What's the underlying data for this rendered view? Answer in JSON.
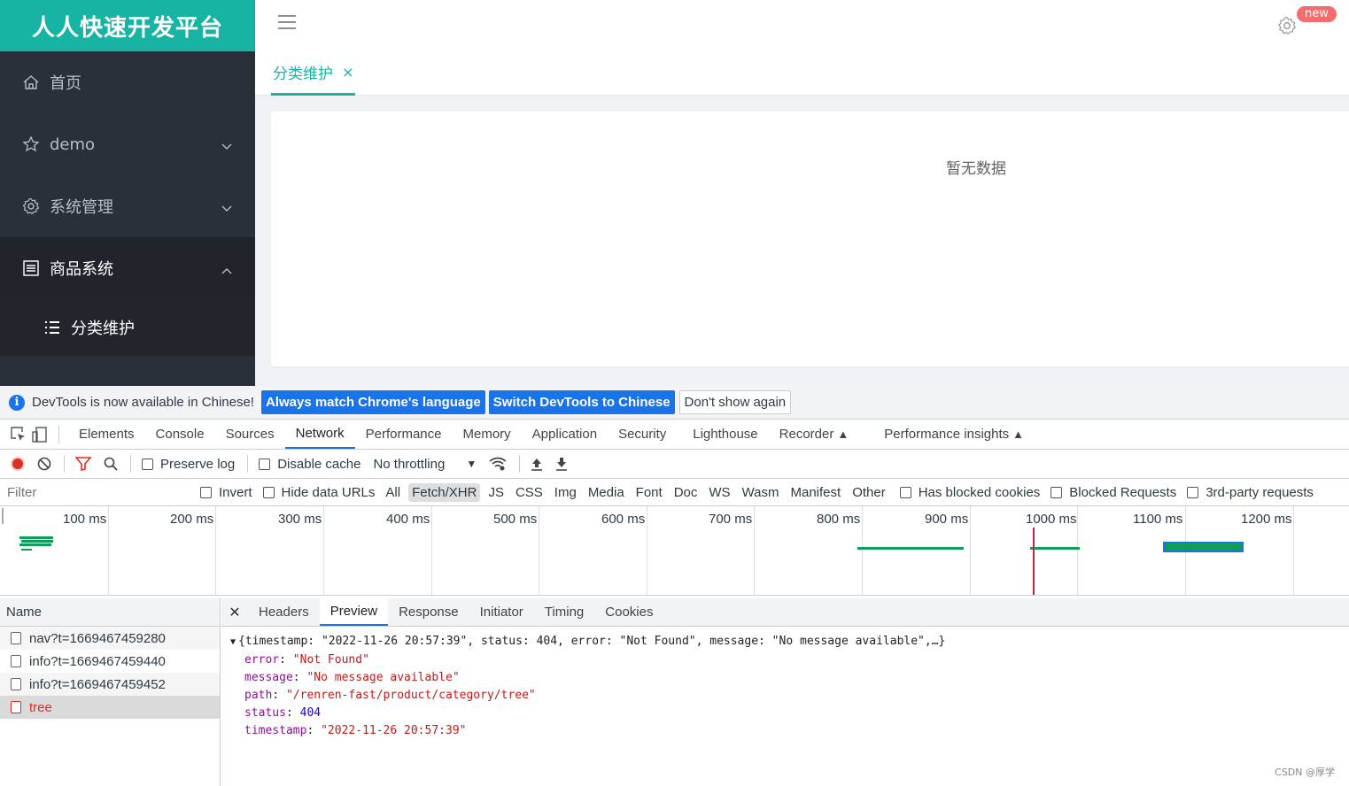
{
  "app": {
    "brand": "人人快速开发平台",
    "menu": [
      {
        "label": "首页",
        "icon": "home-icon"
      },
      {
        "label": "demo",
        "icon": "star-icon"
      },
      {
        "label": "系统管理",
        "icon": "gear-icon"
      },
      {
        "label": "商品系统",
        "icon": "document-icon"
      }
    ],
    "submenu": [
      {
        "label": "分类维护",
        "icon": "list-icon"
      }
    ],
    "new_badge": "new",
    "tab": {
      "label": "分类维护",
      "close": "×"
    },
    "empty_text": "暂无数据",
    "accent_color": "#17b3a3"
  },
  "devtools": {
    "infobar": {
      "message": "DevTools is now available in Chinese!",
      "btn_match": "Always match Chrome's language",
      "btn_switch": "Switch DevTools to Chinese",
      "btn_dismiss": "Don't show again"
    },
    "tabs": [
      "Elements",
      "Console",
      "Sources",
      "Network",
      "Performance",
      "Memory",
      "Application",
      "Security",
      "Lighthouse",
      "Recorder",
      "Performance insights"
    ],
    "active_tab": "Network",
    "toolbar": {
      "preserve_log": "Preserve log",
      "disable_cache": "Disable cache",
      "throttling": "No throttling"
    },
    "filterbar": {
      "placeholder": "Filter",
      "invert": "Invert",
      "hide_data_urls": "Hide data URLs",
      "types": [
        "All",
        "Fetch/XHR",
        "JS",
        "CSS",
        "Img",
        "Media",
        "Font",
        "Doc",
        "WS",
        "Wasm",
        "Manifest",
        "Other"
      ],
      "active_type": "Fetch/XHR",
      "has_blocked_cookies": "Has blocked cookies",
      "blocked_requests": "Blocked Requests",
      "third_party": "3rd-party requests"
    },
    "timeline_ticks": [
      "100 ms",
      "200 ms",
      "300 ms",
      "400 ms",
      "500 ms",
      "600 ms",
      "700 ms",
      "800 ms",
      "900 ms",
      "1000 ms",
      "1100 ms",
      "1200 ms"
    ],
    "name_header": "Name",
    "requests": [
      {
        "name": "nav?t=1669467459280"
      },
      {
        "name": "info?t=1669467459440"
      },
      {
        "name": "info?t=1669467459452"
      },
      {
        "name": "tree",
        "error": true
      }
    ],
    "preview_tabs": [
      "Headers",
      "Preview",
      "Response",
      "Initiator",
      "Timing",
      "Cookies"
    ],
    "active_preview_tab": "Preview",
    "preview": {
      "summary": "{timestamp: \"2022-11-26 20:57:39\", status: 404, error: \"Not Found\", message: \"No message available\",…}",
      "fields": [
        {
          "key": "error",
          "value": "\"Not Found\"",
          "kind": "str"
        },
        {
          "key": "message",
          "value": "\"No message available\"",
          "kind": "str"
        },
        {
          "key": "path",
          "value": "\"/renren-fast/product/category/tree\"",
          "kind": "str"
        },
        {
          "key": "status",
          "value": "404",
          "kind": "num"
        },
        {
          "key": "timestamp",
          "value": "\"2022-11-26 20:57:39\"",
          "kind": "str"
        }
      ]
    },
    "watermark": "CSDN @厚学"
  }
}
